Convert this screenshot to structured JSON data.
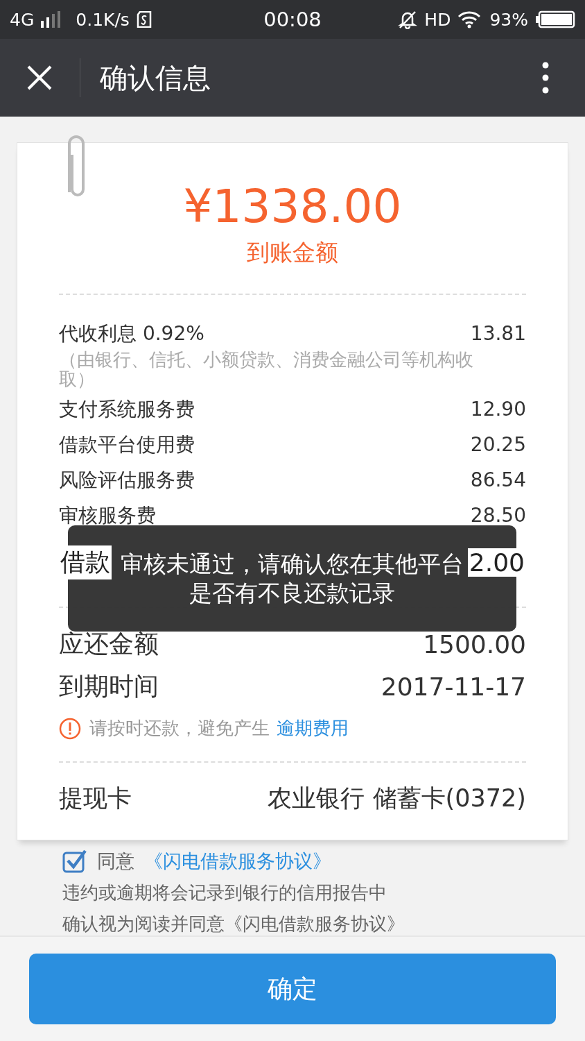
{
  "status_bar": {
    "network": "4G",
    "speed": "0.1K/s",
    "time": "00:08",
    "hd": "HD",
    "battery": "93%"
  },
  "title_bar": {
    "title": "确认信息"
  },
  "receipt": {
    "amount": "¥1338.00",
    "amount_label": "到账金额",
    "interest": {
      "label": "代收利息 0.92%",
      "value": "13.81",
      "note": "（由银行、信托、小额贷款、消费金融公司等机构收取）"
    },
    "fees": [
      {
        "label": "支付系统服务费",
        "value": "12.90"
      },
      {
        "label": "借款平台使用费",
        "value": "20.25"
      },
      {
        "label": "风险评估服务费",
        "value": "86.54"
      },
      {
        "label": "审核服务费",
        "value": "28.50"
      }
    ],
    "total": {
      "label": "借款",
      "value": "2.00"
    },
    "repay": {
      "label": "应还金额",
      "value": "1500.00"
    },
    "due": {
      "label": "到期时间",
      "value": "2017-11-17"
    },
    "notice": {
      "text": "请按时还款，避免产生",
      "link": "逾期费用"
    },
    "card": {
      "label": "提现卡",
      "value": "农业银行 储蓄卡(0372)"
    }
  },
  "agreement": {
    "checked": true,
    "prefix": "同意",
    "link": "《闪电借款服务协议》",
    "note": "违约或逾期将会记录到银行的信用报告中",
    "note_2": "确认视为阅读并同意《闪电借款服务协议》"
  },
  "confirm_button": "确定",
  "toast": {
    "lines": [
      "审核未通过，请确认您在其他平台",
      "是否有不良还款记录"
    ]
  }
}
